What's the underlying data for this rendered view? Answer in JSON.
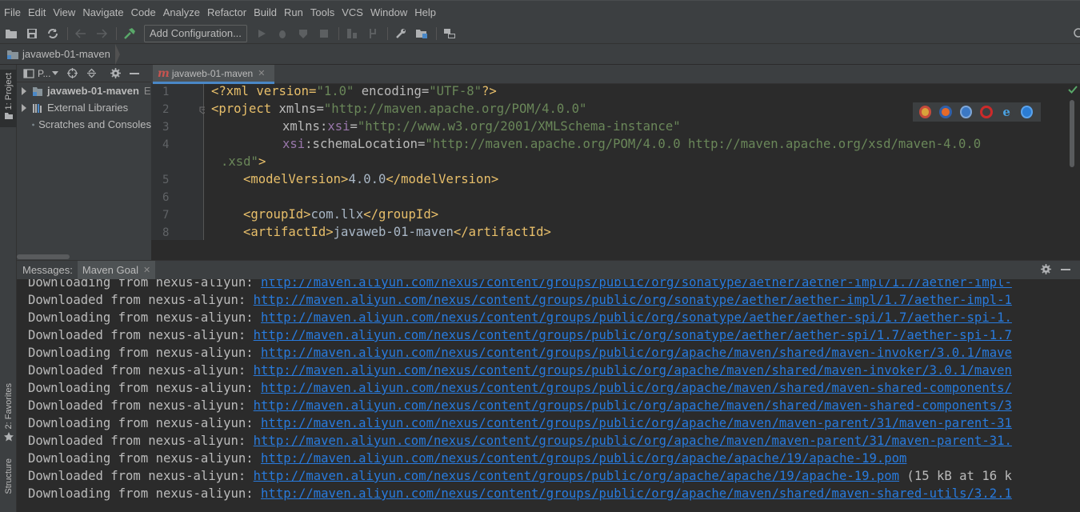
{
  "menu": [
    "File",
    "Edit",
    "View",
    "Navigate",
    "Code",
    "Analyze",
    "Refactor",
    "Build",
    "Run",
    "Tools",
    "VCS",
    "Window",
    "Help"
  ],
  "toolbar": {
    "add_configuration": "Add Configuration..."
  },
  "breadcrumb": {
    "project": "javaweb-01-maven"
  },
  "stripe": {
    "project_tab": "1: Project",
    "favorites_tab": "2: Favorites",
    "structure_tab": "Structure"
  },
  "project_panel": {
    "title": "P...",
    "items": [
      {
        "label": "javaweb-01-maven",
        "suffix": "E"
      },
      {
        "label": "External Libraries"
      },
      {
        "label": "Scratches and Consoles"
      }
    ]
  },
  "editor": {
    "tab": "javaweb-01-maven",
    "line_numbers": [
      "1",
      "2",
      "3",
      "4",
      "",
      "5",
      "6",
      "7",
      "8"
    ],
    "lines": {
      "l1_a": "<?xml version=",
      "l1_b": "\"1.0\"",
      "l1_c": " encoding=",
      "l1_d": "\"UTF-8\"",
      "l1_e": "?>",
      "l2_a": "<project ",
      "l2_b": "xmlns=",
      "l2_c": "\"http://maven.apache.org/POM/4.0.0\"",
      "l3_a": "xmlns:",
      "l3_b": "xsi",
      "l3_c": "=",
      "l3_d": "\"http://www.w3.org/2001/XMLSchema-instance\"",
      "l4_a": "xsi",
      "l4_b": ":schemaLocation=",
      "l4_c": "\"http://maven.apache.org/POM/4.0.0 http://maven.apache.org/xsd/maven-4.0.0",
      "l4w_a": ".xsd\"",
      "l4w_b": ">",
      "l5_a": "<modelVersion>",
      "l5_b": "4.0.0",
      "l5_c": "</modelVersion>",
      "l7_a": "<groupId>",
      "l7_b": "com.llx",
      "l7_c": "</groupId>",
      "l8_a": "<artifactId>",
      "l8_b": "javaweb-01-maven",
      "l8_c": "</artifactId>"
    }
  },
  "messages": {
    "label": "Messages:",
    "tab": "Maven Goal",
    "lines": [
      {
        "prefix": "Downloading from nexus-aliyun: ",
        "url": "http://maven.aliyun.com/nexus/content/groups/public/org/sonatype/aether/aether-impl/1.7/aether-impl-",
        "suffix": ""
      },
      {
        "prefix": "Downloaded from nexus-aliyun: ",
        "url": "http://maven.aliyun.com/nexus/content/groups/public/org/sonatype/aether/aether-impl/1.7/aether-impl-1",
        "suffix": ""
      },
      {
        "prefix": "Downloading from nexus-aliyun: ",
        "url": "http://maven.aliyun.com/nexus/content/groups/public/org/sonatype/aether/aether-spi/1.7/aether-spi-1.",
        "suffix": ""
      },
      {
        "prefix": "Downloaded from nexus-aliyun: ",
        "url": "http://maven.aliyun.com/nexus/content/groups/public/org/sonatype/aether/aether-spi/1.7/aether-spi-1.7",
        "suffix": ""
      },
      {
        "prefix": "Downloading from nexus-aliyun: ",
        "url": "http://maven.aliyun.com/nexus/content/groups/public/org/apache/maven/shared/maven-invoker/3.0.1/mave",
        "suffix": ""
      },
      {
        "prefix": "Downloaded from nexus-aliyun: ",
        "url": "http://maven.aliyun.com/nexus/content/groups/public/org/apache/maven/shared/maven-invoker/3.0.1/maven",
        "suffix": ""
      },
      {
        "prefix": "Downloading from nexus-aliyun: ",
        "url": "http://maven.aliyun.com/nexus/content/groups/public/org/apache/maven/shared/maven-shared-components/",
        "suffix": ""
      },
      {
        "prefix": "Downloaded from nexus-aliyun: ",
        "url": "http://maven.aliyun.com/nexus/content/groups/public/org/apache/maven/shared/maven-shared-components/3",
        "suffix": ""
      },
      {
        "prefix": "Downloading from nexus-aliyun: ",
        "url": "http://maven.aliyun.com/nexus/content/groups/public/org/apache/maven/maven-parent/31/maven-parent-31",
        "suffix": ""
      },
      {
        "prefix": "Downloaded from nexus-aliyun: ",
        "url": "http://maven.aliyun.com/nexus/content/groups/public/org/apache/maven/maven-parent/31/maven-parent-31.",
        "suffix": ""
      },
      {
        "prefix": "Downloading from nexus-aliyun: ",
        "url": "http://maven.aliyun.com/nexus/content/groups/public/org/apache/apache/19/apache-19.pom",
        "suffix": ""
      },
      {
        "prefix": "Downloaded from nexus-aliyun: ",
        "url": "http://maven.aliyun.com/nexus/content/groups/public/org/apache/apache/19/apache-19.pom",
        "suffix": " (15 kB at 16 k"
      },
      {
        "prefix": "Downloading from nexus-aliyun: ",
        "url": "http://maven.aliyun.com/nexus/content/groups/public/org/apache/maven/shared/maven-shared-utils/3.2.1",
        "suffix": ""
      }
    ]
  },
  "colors": {
    "accent": "#4a88c7",
    "link": "#287bde",
    "tag": "#e8bf6a",
    "string": "#6a8759"
  }
}
